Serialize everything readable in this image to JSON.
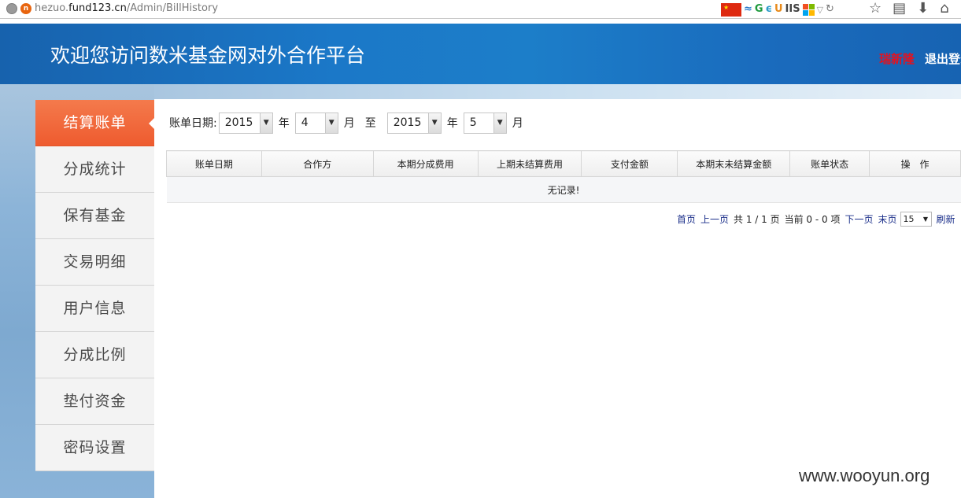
{
  "browser": {
    "url_prefix": "hezuo.",
    "url_host": "fund123.cn",
    "url_path": "/Admin/BillHistory"
  },
  "header": {
    "title": "欢迎您访问数米基金网对外合作平台",
    "user": "瑞新隆",
    "logout": "退出登录"
  },
  "sidebar": {
    "items": [
      {
        "label": "结算账单",
        "active": true
      },
      {
        "label": "分成统计"
      },
      {
        "label": "保有基金"
      },
      {
        "label": "交易明细"
      },
      {
        "label": "用户信息"
      },
      {
        "label": "分成比例"
      },
      {
        "label": "垫付资金"
      },
      {
        "label": "密码设置"
      }
    ]
  },
  "filter": {
    "label": "账单日期:",
    "from_year": "2015",
    "year_unit": "年",
    "from_month": "4",
    "month_unit": "月",
    "to_text": "至",
    "to_year": "2015",
    "to_month": "5"
  },
  "table": {
    "columns": [
      "账单日期",
      "合作方",
      "本期分成费用",
      "上期未结算费用",
      "支付金额",
      "本期末未结算金额",
      "账单状态",
      "操　作"
    ],
    "empty_text": "无记录!"
  },
  "pager": {
    "first": "首页",
    "prev": "上一页",
    "total_text": "共 1 / 1 页",
    "range_text": "当前 0 - 0 项",
    "next": "下一页",
    "last": "末页",
    "page_size": "15",
    "refresh": "刷新"
  },
  "watermark": "www.wooyun.org"
}
